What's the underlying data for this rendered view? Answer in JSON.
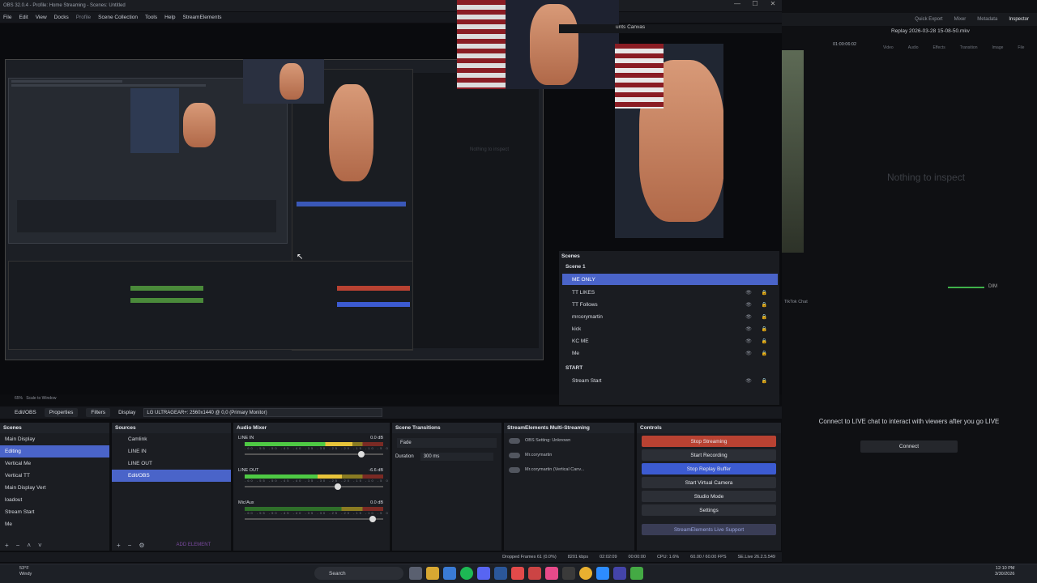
{
  "window": {
    "title": "OBS 32.0.4 - Profile: Home Streaming - Scenes: Untitled",
    "controls": [
      "—",
      "☐",
      "✕"
    ]
  },
  "menu": [
    "File",
    "Edit",
    "View",
    "Docks",
    "Profile",
    "Scene Collection",
    "Tools",
    "Help",
    "StreamElements"
  ],
  "preview": {
    "nothing_to_inspect_small": "Nothing to inspect",
    "dock_title": "unts Canvas",
    "cursor": "↖"
  },
  "scenes_dock": {
    "title": "Scenes",
    "groups": [
      {
        "name": "Scene 1"
      },
      {
        "name": "START"
      }
    ],
    "items": [
      {
        "label": "ME ONLY",
        "selected": true
      },
      {
        "label": "TT LIKES"
      },
      {
        "label": "TT Follows"
      },
      {
        "label": "mrcorymartin"
      },
      {
        "label": "kick"
      },
      {
        "label": "KC ME"
      },
      {
        "label": "Me"
      },
      {
        "label": "Stream Start"
      }
    ],
    "icons": "👁 🔒"
  },
  "right_app": {
    "tabs": [
      "Quick Export",
      "Mixer",
      "Metadata",
      "Inspector"
    ],
    "clip_name": "Replay 2026-03-28 15-08-50.mkv",
    "timecode": "01:00:06:02",
    "subtabs": [
      "Video",
      "Audio",
      "Effects",
      "Transition",
      "Image",
      "File"
    ],
    "nothing_to_inspect": "Nothing to inspect",
    "dim_label": "DIM",
    "tiktok_label": "TikTok Chat",
    "connect_text": "Connect to LIVE chat to interact with viewers after you go LIVE",
    "connect_button": "Connect"
  },
  "status_line": {
    "zoom": "65%",
    "scale": "Scale to Window"
  },
  "prop_bar": {
    "source": "Edit/OBS",
    "properties": "Properties",
    "filters": "Filters",
    "display_label": "Display",
    "display_value": "LG ULTRAGEAR+: 2560x1440 @ 0,0 (Primary Monitor)"
  },
  "scenes": {
    "title": "Scenes",
    "items": [
      "Main Display",
      "Editing",
      "Vertical Me",
      "Vertical TT",
      "Main Display Vert",
      "loadout",
      "Stream Start",
      "Me"
    ],
    "selected_index": 1
  },
  "sources": {
    "title": "Sources",
    "items": [
      "Camlink",
      "LINE IN",
      "LINE OUT",
      "Edit/OBS"
    ],
    "selected_index": 3,
    "add_element": "ADD ELEMENT"
  },
  "audio_mixer": {
    "title": "Audio Mixer",
    "channels": [
      {
        "name": "LINE IN",
        "db": "0.0 dB",
        "level": 0.78,
        "fader": 0.82
      },
      {
        "name": "LINE OUT",
        "db": "-6.6 dB",
        "level": 0.7,
        "fader": 0.65
      },
      {
        "name": "Mic/Aux",
        "db": "0.0 dB",
        "level": 0,
        "fader": 0.9
      }
    ],
    "scale": "-60 -55 -50 -45 -40 -35 -30 -25 -20 -15 -10 -5 0"
  },
  "transitions": {
    "title": "Scene Transitions",
    "type": "Fade",
    "duration_label": "Duration",
    "duration_value": "300 ms"
  },
  "multistream": {
    "title": "StreamElements Multi-Streaming",
    "obs_setting": "OBS Setting: Unknown",
    "account1": "Mr.corymartin",
    "account2": "Mr.corymartin (Vertical Canv..."
  },
  "controls": {
    "title": "Controls",
    "stop_streaming": "Stop Streaming",
    "start_recording": "Start Recording",
    "stop_replay": "Stop Replay Buffer",
    "start_virtual": "Start Virtual Camera",
    "studio_mode": "Studio Mode",
    "settings": "Settings",
    "live_support": "StreamElements Live Support"
  },
  "statusbar": {
    "dropped": "Dropped Frames 61 (0.0%)",
    "kbps": "8201 kbps",
    "live_time": "02:02:09",
    "rec_time": "00:00:00",
    "cpu": "CPU: 1.6%",
    "fps": "60.00 / 60.00 FPS",
    "se": "SE.Live 26.2.5.549"
  },
  "taskbar": {
    "weather_temp": "53°F",
    "weather_desc": "Windy",
    "search": "Search",
    "time": "12:10 PM",
    "date": "3/30/2026"
  }
}
